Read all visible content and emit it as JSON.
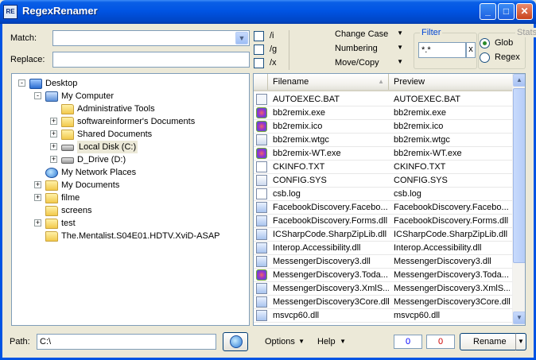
{
  "window": {
    "title": "RegexRenamer",
    "app_icon": "regex-app-icon"
  },
  "titlebar_buttons": {
    "minimize": "_",
    "maximize": "□",
    "close": "✕"
  },
  "match": {
    "label": "Match:",
    "value": ""
  },
  "replace": {
    "label": "Replace:",
    "value": ""
  },
  "options_flags": [
    {
      "label": "/i",
      "checked": false
    },
    {
      "label": "/g",
      "checked": false
    },
    {
      "label": "/x",
      "checked": false
    }
  ],
  "menus": {
    "change_case": "Change Case",
    "numbering": "Numbering",
    "move_copy": "Move/Copy"
  },
  "filter": {
    "title": "Filter",
    "value": "*.*",
    "clear": "x"
  },
  "stats": {
    "title": "Stats",
    "glob": "Glob",
    "regex": "Regex",
    "selected": "Glob"
  },
  "tree": [
    {
      "label": "Desktop",
      "icon": "desktop-icon",
      "expander": "-"
    },
    {
      "label": "My Computer",
      "icon": "computer-icon",
      "expander": "-"
    },
    {
      "label": "Administrative Tools",
      "icon": "folder-icon",
      "expander": ""
    },
    {
      "label": "softwareinformer's Documents",
      "icon": "folder-icon",
      "expander": "+"
    },
    {
      "label": "Shared Documents",
      "icon": "folder-icon",
      "expander": "+"
    },
    {
      "label": "Local Disk (C:)",
      "icon": "drive-icon",
      "expander": "+"
    },
    {
      "label": "D_Drive (D:)",
      "icon": "drive-icon",
      "expander": "+"
    },
    {
      "label": "My Network Places",
      "icon": "network-icon",
      "expander": ""
    },
    {
      "label": "My Documents",
      "icon": "folder-icon",
      "expander": "+"
    },
    {
      "label": "filme",
      "icon": "folder-icon",
      "expander": "+"
    },
    {
      "label": "screens",
      "icon": "folder-icon",
      "expander": ""
    },
    {
      "label": "test",
      "icon": "folder-icon",
      "expander": "+"
    },
    {
      "label": "The.Mentalist.S04E01.HDTV.XviD-ASAP",
      "icon": "folder-icon",
      "expander": ""
    }
  ],
  "filelist": {
    "columns": {
      "filename": "Filename",
      "preview": "Preview"
    },
    "rows": [
      {
        "filename": "AUTOEXEC.BAT",
        "preview": "AUTOEXEC.BAT",
        "icon": "bat"
      },
      {
        "filename": "bb2remix.exe",
        "preview": "bb2remix.exe",
        "icon": "exe"
      },
      {
        "filename": "bb2remix.ico",
        "preview": "bb2remix.ico",
        "icon": "exe"
      },
      {
        "filename": "bb2remix.wtgc",
        "preview": "bb2remix.wtgc",
        "icon": "sys"
      },
      {
        "filename": "bb2remix-WT.exe",
        "preview": "bb2remix-WT.exe",
        "icon": "exe"
      },
      {
        "filename": "CKINFO.TXT",
        "preview": "CKINFO.TXT",
        "icon": "txt"
      },
      {
        "filename": "CONFIG.SYS",
        "preview": "CONFIG.SYS",
        "icon": "sys"
      },
      {
        "filename": "csb.log",
        "preview": "csb.log",
        "icon": "txt"
      },
      {
        "filename": "FacebookDiscovery.Facebo...",
        "preview": "FacebookDiscovery.Facebo...",
        "icon": "dll"
      },
      {
        "filename": "FacebookDiscovery.Forms.dll",
        "preview": "FacebookDiscovery.Forms.dll",
        "icon": "dll"
      },
      {
        "filename": "ICSharpCode.SharpZipLib.dll",
        "preview": "ICSharpCode.SharpZipLib.dll",
        "icon": "dll"
      },
      {
        "filename": "Interop.Accessibility.dll",
        "preview": "Interop.Accessibility.dll",
        "icon": "dll"
      },
      {
        "filename": "MessengerDiscovery3.dll",
        "preview": "MessengerDiscovery3.dll",
        "icon": "dll"
      },
      {
        "filename": "MessengerDiscovery3.Toda...",
        "preview": "MessengerDiscovery3.Toda...",
        "icon": "exe"
      },
      {
        "filename": "MessengerDiscovery3.XmlS...",
        "preview": "MessengerDiscovery3.XmlS...",
        "icon": "dll"
      },
      {
        "filename": "MessengerDiscovery3Core.dll",
        "preview": "MessengerDiscovery3Core.dll",
        "icon": "dll"
      },
      {
        "filename": "msvcp60.dll",
        "preview": "msvcp60.dll",
        "icon": "dll"
      }
    ]
  },
  "path": {
    "label": "Path:",
    "value": "C:\\"
  },
  "bottom_menus": {
    "options": "Options",
    "help": "Help"
  },
  "counts": {
    "left": "0",
    "right": "0",
    "left_color": "#0000ff",
    "right_color": "#cc0000"
  },
  "rename": {
    "label": "Rename"
  }
}
